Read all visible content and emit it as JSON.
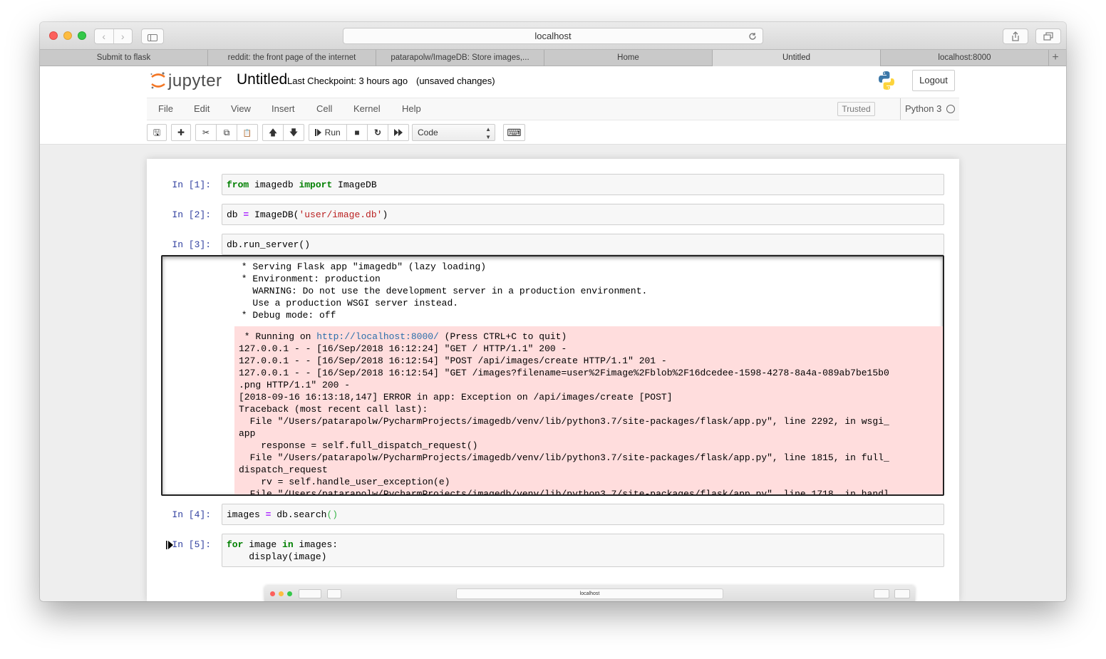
{
  "browser": {
    "url": "localhost",
    "reload_icon": "reload-icon",
    "back_glyph": "‹",
    "forward_glyph": "›",
    "tabs": [
      {
        "label": "Submit to flask"
      },
      {
        "label": "reddit: the front page of the internet"
      },
      {
        "label": "patarapolw/ImageDB: Store images,..."
      },
      {
        "label": "Home"
      },
      {
        "label": "Untitled"
      },
      {
        "label": "localhost:8000"
      }
    ],
    "active_tab": 4,
    "new_tab_glyph": "+"
  },
  "header": {
    "logo_text": "jupyter",
    "notebook_title": "Untitled",
    "checkpoint": "Last Checkpoint: 3 hours ago",
    "unsaved": "(unsaved changes)",
    "logout_label": "Logout"
  },
  "menubar": {
    "items": [
      "File",
      "Edit",
      "View",
      "Insert",
      "Cell",
      "Kernel",
      "Help"
    ],
    "trusted_label": "Trusted",
    "kernel_name": "Python 3"
  },
  "toolbar": {
    "save_glyph": "🖫",
    "add_glyph": "✚",
    "cut_glyph": "✂",
    "copy_glyph": "⧉",
    "paste_glyph": "📋",
    "up_glyph": "🡅",
    "down_glyph": "🡇",
    "run_label": "Run",
    "stop_glyph": "■",
    "restart_glyph": "↻",
    "fastforward_glyph": "⏩",
    "cell_type": "Code",
    "keyboard_glyph": "⌨"
  },
  "cells": {
    "c1": {
      "prompt": "In [1]:",
      "t1": "from",
      "t2": " imagedb ",
      "t3": "import",
      "t4": " ImageDB"
    },
    "c2": {
      "prompt": "In [2]:",
      "t1": "db ",
      "t2": "=",
      "t3": " ImageDB(",
      "t4": "'user/image.db'",
      "t5": ")"
    },
    "c3": {
      "prompt": "In [3]:",
      "code": "db.run_server()"
    },
    "c3_stdout": " * Serving Flask app \"imagedb\" (lazy loading)\n * Environment: production\n   WARNING: Do not use the development server in a production environment.\n   Use a production WSGI server instead.\n * Debug mode: off",
    "c3_stderr": {
      "line1_pre": " * Running on ",
      "line1_link": "http://localhost:8000/",
      "line1_post": " (Press CTRL+C to quit)",
      "rest": "127.0.0.1 - - [16/Sep/2018 16:12:24] \"GET / HTTP/1.1\" 200 -\n127.0.0.1 - - [16/Sep/2018 16:12:54] \"POST /api/images/create HTTP/1.1\" 201 -\n127.0.0.1 - - [16/Sep/2018 16:12:54] \"GET /images?filename=user%2Fimage%2Fblob%2F16dcedee-1598-4278-8a4a-089ab7be15b0\n.png HTTP/1.1\" 200 -\n[2018-09-16 16:13:18,147] ERROR in app: Exception on /api/images/create [POST]\nTraceback (most recent call last):\n  File \"/Users/patarapolw/PycharmProjects/imagedb/venv/lib/python3.7/site-packages/flask/app.py\", line 2292, in wsgi_\napp\n    response = self.full_dispatch_request()\n  File \"/Users/patarapolw/PycharmProjects/imagedb/venv/lib/python3.7/site-packages/flask/app.py\", line 1815, in full_\ndispatch_request\n    rv = self.handle_user_exception(e)\n  File \"/Users/patarapolw/PycharmProjects/imagedb/venv/lib/python3.7/site-packages/flask/app.py\", line 1718, in handl"
    },
    "c4": {
      "prompt": "In [4]:",
      "t1": "images ",
      "t2": "=",
      "t3": " db.search",
      "t4": "()"
    },
    "c5": {
      "prompt": "In [5]:",
      "t1": "for",
      "t2": " image ",
      "t3": "in",
      "t4": " images:\n    display(image)"
    }
  },
  "mini_window": {
    "url": "localhost"
  },
  "colors": {
    "jupyter_orange": "#f37726",
    "prompt_blue": "#303f9f",
    "keyword_green": "#008000",
    "string_red": "#ba2121",
    "operator_purple": "#aa22ff",
    "stderr_bg": "#ffdddd"
  }
}
